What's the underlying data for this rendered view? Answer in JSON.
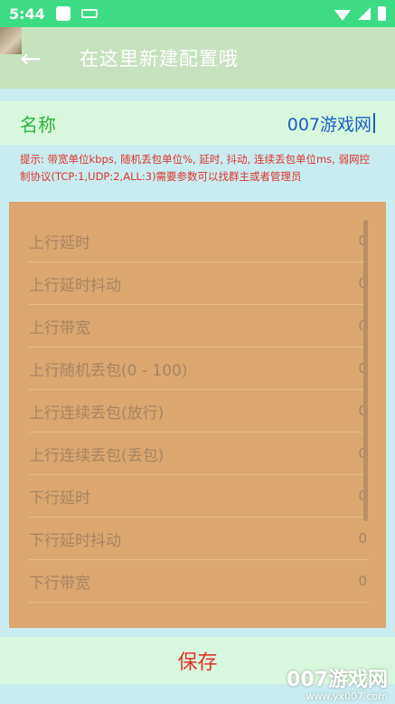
{
  "status_bar": {
    "time": "5:44"
  },
  "app_bar": {
    "back_icon": "←",
    "title": "在这里新建配置哦"
  },
  "name_field": {
    "label": "名称",
    "value": "007游戏网"
  },
  "hint": "提示: 带宽单位kbps, 随机丢包单位%, 延时, 抖动, 连续丢包单位ms, 弱网控制协议(TCP:1,UDP:2,ALL:3)需要参数可以找群主或者管理员",
  "params": [
    {
      "label": "上行延时",
      "value": "0"
    },
    {
      "label": "上行延时抖动",
      "value": "0"
    },
    {
      "label": "上行带宽",
      "value": "0"
    },
    {
      "label": "上行随机丢包(0 - 100)",
      "value": "0"
    },
    {
      "label": "上行连续丢包(放行)",
      "value": "0"
    },
    {
      "label": "上行连续丢包(丢包)",
      "value": "0"
    },
    {
      "label": "下行延时",
      "value": "0"
    },
    {
      "label": "下行延时抖动",
      "value": "0"
    },
    {
      "label": "下行带宽",
      "value": "0"
    }
  ],
  "save_label": "保存",
  "watermark": {
    "brand": "007游戏网",
    "url": "www.yx007.com"
  },
  "colors": {
    "status_bar": "#3ddc84",
    "app_bar": "#c5e3bd",
    "panel": "#dca670",
    "accent_red": "#e0332d",
    "label_green": "#2ab53a",
    "value_blue": "#1b5fc2"
  }
}
